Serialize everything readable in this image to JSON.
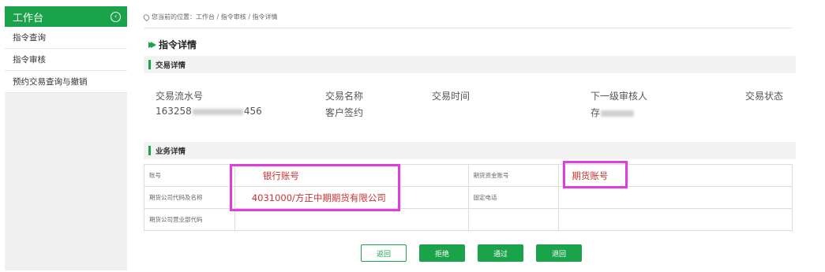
{
  "sidebar": {
    "title": "工作台",
    "items": [
      {
        "label": "指令查询"
      },
      {
        "label": "指令审核"
      },
      {
        "label": "预约交易查询与撤销"
      }
    ]
  },
  "breadcrumb": "您当前的位置：工作台 / 指令审核 / 指令详情",
  "page_title": "指令详情",
  "transaction": {
    "section_title": "交易详情",
    "headers": [
      "交易流水号",
      "交易名称",
      "交易时间",
      "下一级审核人",
      "交易状态"
    ],
    "serial_prefix": "163258",
    "serial_suffix": "456",
    "name": "客户签约",
    "reviewer_prefix": "存"
  },
  "business": {
    "section_title": "业务详情",
    "rows": [
      {
        "l1": "账号",
        "v1": "银行账号",
        "l2": "期货资金账号",
        "v2": "期货账号"
      },
      {
        "l1": "期货公司代码及名称",
        "v1": "4031000/方正中期期货有限公司",
        "l2": "固定电话",
        "v2": ""
      },
      {
        "l1": "期货公司营业部代码",
        "v1": "",
        "l2": "",
        "v2": ""
      }
    ]
  },
  "buttons": {
    "back": "返回",
    "reject": "拒绝",
    "approve": "通过",
    "return": "退回"
  },
  "colors": {
    "brand": "#1aa34a",
    "highlight": "#e23be0",
    "value_red": "#cc3333"
  }
}
